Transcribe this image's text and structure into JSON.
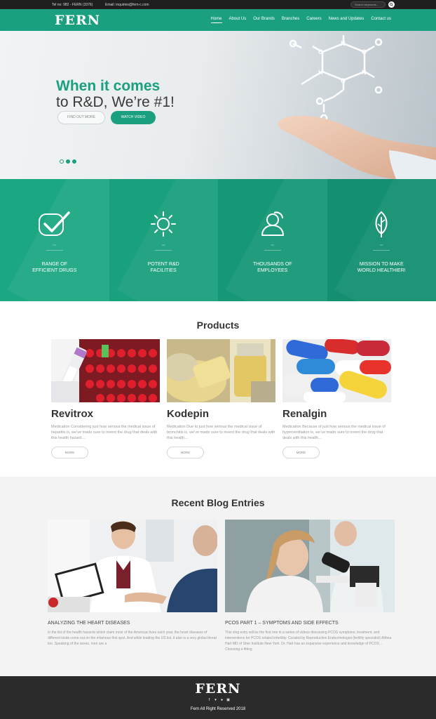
{
  "topbar": {
    "phone": "Tel no: 982 - FERN (3376)",
    "email": "Email: inquiries@fern-c.com",
    "search_placeholder": "Search keywords..."
  },
  "nav": {
    "logo": "FERN",
    "items": [
      {
        "label": "Home",
        "active": true
      },
      {
        "label": "About Us"
      },
      {
        "label": "Our Brands"
      },
      {
        "label": "Branches"
      },
      {
        "label": "Careers"
      },
      {
        "label": "News and Updates"
      },
      {
        "label": "Contact us"
      }
    ]
  },
  "hero": {
    "title_line1": "When it comes",
    "title_line2": "to R&D, We’re #1!",
    "btn_find": "FIND OUT MORE",
    "btn_video": "WATCH VIDEO",
    "slides": 3,
    "active_slide": 2
  },
  "features": [
    {
      "icon": "check-icon",
      "num": "01/",
      "label": "RANGE OF\nEFFICIENT DRUGS",
      "bg": "#1ca783"
    },
    {
      "icon": "sun-icon",
      "num": "02/",
      "label": "POTENT R&D\nFACILITIES",
      "bg": "#19a07d"
    },
    {
      "icon": "employees-icon",
      "num": "03/",
      "label": "THOUSANDS OF\nEMPLOYEES",
      "bg": "#169877"
    },
    {
      "icon": "leaf-icon",
      "num": "04/",
      "label": "MISSION TO MAKE\nWORLD HEALTHIER!",
      "bg": "#149071"
    }
  ],
  "products": {
    "title": "Products",
    "items": [
      {
        "name": "Revitrox",
        "desc": "Medication Considering just how serious the medical issue of hepatitis is, we’ve made sure to invent the drug that deals with this health hazard…",
        "btn": "MORE"
      },
      {
        "name": "Kodepin",
        "desc": "Medication Due to just how serious the medical issue of bronchitis is, we’ve made sure to invent the drug that deals with this health…",
        "btn": "MORE"
      },
      {
        "name": "Renalgin",
        "desc": "Medication Because of just how serious the medical issue of hyperventilation is, we’ve made sure to invent the drug that deals with this health…",
        "btn": "MORE"
      }
    ]
  },
  "blog": {
    "title": "Recent Blog Entries",
    "posts": [
      {
        "title": "ANALYZING THE HEART DISEASES",
        "desc": "In the list of the health hazards which claim most of the American lives each year, the heart diseases of different kinds come out on the infamous first spot. And while leading the US list, it also is a very global threat too. Speaking of the sexes, men are a"
      },
      {
        "title": "PCOS PART 1 – SYMPTOMS AND SIDE EFFECTS",
        "desc": "This vlog entry will be the first one in a series of videos discussing PCOS symptoms, treatment, and interventions for PCOS related infertility. Curated by Reproductive Endocrinologist (fertility specialist) Althea Hart MD of Sher Institute New York. Dr. Hart has an expansive experience and knowledge of PCOS… Choosing a fitting"
      }
    ]
  },
  "footer": {
    "logo": "FERN",
    "social": [
      "facebook-icon",
      "twitter-icon",
      "pinterest-icon",
      "youtube-icon"
    ],
    "copyright": "Fern All Right Reserved 2018"
  },
  "colors": {
    "accent": "#1aa07f",
    "topbar": "#1f1f1f",
    "footer": "#2b2b2b"
  }
}
